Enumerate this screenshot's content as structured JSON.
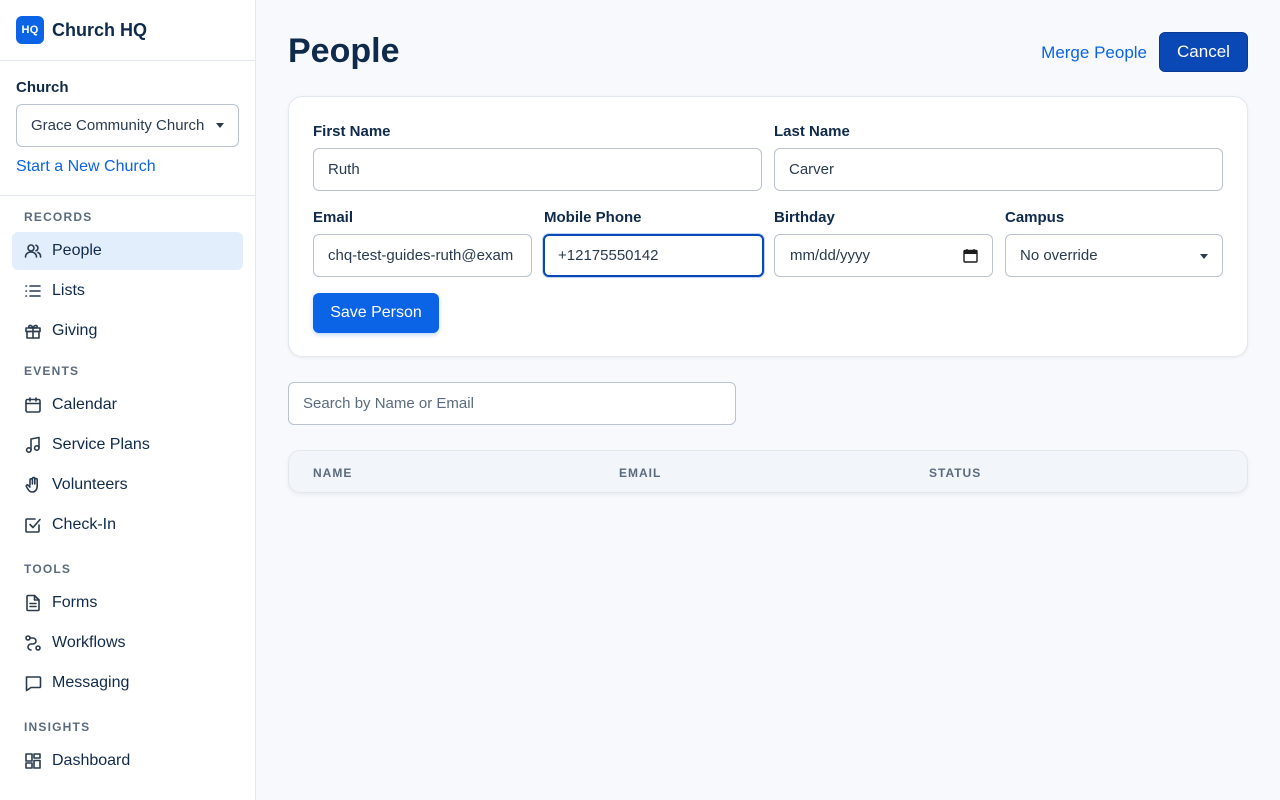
{
  "brand": {
    "logo_text": "HQ",
    "name": "Church HQ"
  },
  "church": {
    "label": "Church",
    "selected": "Grace Community Church",
    "start_link": "Start a New Church"
  },
  "nav": {
    "records": {
      "heading": "RECORDS",
      "items": [
        {
          "label": "People",
          "icon": "people-icon",
          "active": true
        },
        {
          "label": "Lists",
          "icon": "list-icon"
        },
        {
          "label": "Giving",
          "icon": "gift-icon"
        }
      ]
    },
    "events": {
      "heading": "EVENTS",
      "items": [
        {
          "label": "Calendar",
          "icon": "calendar-icon"
        },
        {
          "label": "Service Plans",
          "icon": "music-note-icon"
        },
        {
          "label": "Volunteers",
          "icon": "hand-icon"
        },
        {
          "label": "Check-In",
          "icon": "checkbox-icon"
        }
      ]
    },
    "tools": {
      "heading": "TOOLS",
      "items": [
        {
          "label": "Forms",
          "icon": "document-icon"
        },
        {
          "label": "Workflows",
          "icon": "workflow-icon"
        },
        {
          "label": "Messaging",
          "icon": "chat-icon"
        }
      ]
    },
    "insights": {
      "heading": "INSIGHTS",
      "items": [
        {
          "label": "Dashboard",
          "icon": "dashboard-icon"
        }
      ]
    }
  },
  "header": {
    "title": "People",
    "merge_link": "Merge People",
    "cancel_label": "Cancel"
  },
  "form": {
    "first_name": {
      "label": "First Name",
      "value": "Ruth"
    },
    "last_name": {
      "label": "Last Name",
      "value": "Carver"
    },
    "email": {
      "label": "Email",
      "value": "chq-test-guides-ruth@exam"
    },
    "mobile_phone": {
      "label": "Mobile Phone",
      "value": "+12175550142"
    },
    "birthday": {
      "label": "Birthday",
      "placeholder": "mm/dd/yyyy"
    },
    "campus": {
      "label": "Campus",
      "value": "No override"
    },
    "save_label": "Save Person"
  },
  "search": {
    "placeholder": "Search by Name or Email"
  },
  "table": {
    "columns": [
      "NAME",
      "EMAIL",
      "STATUS"
    ]
  },
  "colors": {
    "accent": "#0b63e5",
    "accent_dark": "#0a48b5",
    "text": "#0f2a4a"
  }
}
